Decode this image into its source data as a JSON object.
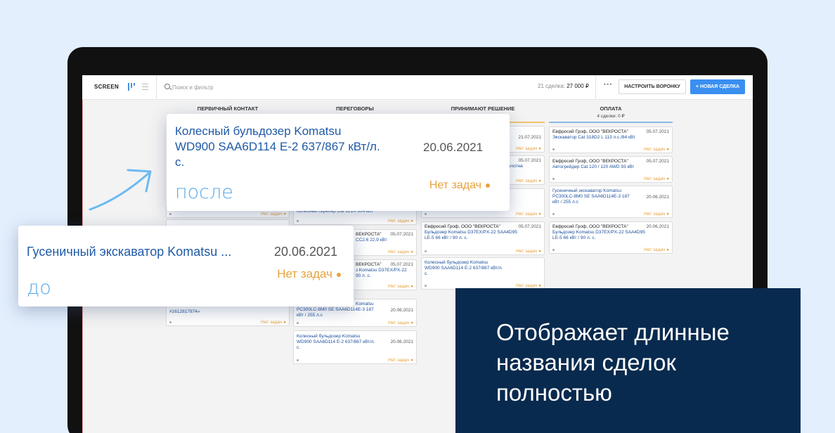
{
  "app": {
    "brand": "SCREEN"
  },
  "toolbar": {
    "search_placeholder": "Поиск и фильтр",
    "summary_count": "21 сделка:",
    "summary_amount": "27 000 ₽",
    "more_label": "···",
    "setup_label": "НАСТРОИТЬ ВОРОНКУ",
    "new_deal_label": "+ НОВАЯ СДЕЛКА"
  },
  "columns": [
    {
      "title": "ПЕРВИЧНЫЙ КОНТАКТ",
      "subtitle": "",
      "color": "#f0c36d"
    },
    {
      "title": "ПЕРЕГОВОРЫ",
      "subtitle": "",
      "color": "#f0c36d"
    },
    {
      "title": "ПРИНИМАЮТ РЕШЕНИЕ",
      "subtitle": "",
      "color": "#f0c36d"
    },
    {
      "title": "ОПЛАТА",
      "subtitle": "4 сделки: 0 ₽",
      "color": "#8cb8e8"
    }
  ],
  "cards": {
    "c1_a": {
      "task": "Нет задач ●"
    },
    "c1_b": {
      "title": "#1612817974»",
      "task": "Нет задач ●"
    },
    "c2_a": {
      "title": "Колесный скрепер Cat 621K 304 кВт",
      "task": "Нет задач ●"
    },
    "c2_b": {
      "contact": "ВЕКРОСТА\"",
      "date": "05.07.2021",
      "title": "СС2.6 22,9 кВт",
      "task": "Нет задач ●"
    },
    "c2_c": {
      "contact": "ВЕКРОСТА\"",
      "date": "05.07.2021",
      "title": "з Komatsu D37EX/PX-22",
      "title2": "90 л. с.",
      "task": "Нет задач ●"
    },
    "c2_d": {
      "title": "Komatsu",
      "title2": "PC300LC-8M0 SE SAA6D114E-3 187",
      "title3": "кВт / 255 л.с",
      "date": "20.06.2021",
      "task": "Нет задач ●"
    },
    "c2_e": {
      "title": "Колесный бульдозер Komatsu",
      "title2": "WD900 SAA6D114 E-2 637/867 кВт/л.",
      "title3": "с.",
      "date": "20.06.2021",
      "task": "Нет задач ●"
    },
    "c3_a": {
      "date": "21.07.2021",
      "task": "Нет задач ●"
    },
    "c3_b": {
      "date": "05.07.2021",
      "title": "ого полотна",
      "task": "Нет задач ●"
    },
    "c3_c": {
      "title": "В3",
      "task": "Нет задач ●"
    },
    "c3_d": {
      "contact": "Евфросий Гроф, ООО \"ВЕКРОСТА\"",
      "date": "05.07.2021",
      "title": "Бульдозер Komatsu D37EX/PX-22 SAA4D95",
      "title2": "LE-5 66 кВт / 90 л. с.",
      "task": "Нет задач ●"
    },
    "c3_e": {
      "title": "Колесный бульдозер Komatsu",
      "title2": "WD900 SAA6D114 E-2 637/867 кВт/л.",
      "title3": "с.",
      "date": "20.06.2021",
      "task": "Нет задач ●"
    },
    "c4_a": {
      "contact": "Евфросий Гроф, ООО \"ВЕКРОСТА\"",
      "date": "05.07.2021",
      "title": "Экскаватор Cat 318D2 L 113 л.с./84 кВт",
      "task": "Нет задач ●"
    },
    "c4_b": {
      "contact": "Евфросий Гроф, ООО \"ВЕКРОСТА\"",
      "date": "05.07.2021",
      "title": "Автогрейдер Cat 120 / 120 AWD 93 кВт",
      "task": "Нет задач ●"
    },
    "c4_c": {
      "title": "Гусеничный экскаватор Komatsu",
      "title2": "PC300LC-8M0 SE SAA6D114E-3 187",
      "title3": "кВт / 255 л.с",
      "date": "20.06.2021",
      "task": "Нет задач ●"
    },
    "c4_d": {
      "contact": "Евфросий Гроф, ООО \"ВЕКРОСТА\"",
      "date": "20.06.2021",
      "title": "Бульдозер Komatsu D37EX/PX-22 SAA4D95",
      "title2": "LE-5 66 кВт / 90 л. с.",
      "task": "Нет задач ●"
    }
  },
  "zoom_after": {
    "title_line1": "Колесный бульдозер Komatsu",
    "title_line2": "WD900 SAA6D114 E-2 637/867 кВт/л.",
    "title_line3": "с.",
    "date": "20.06.2021",
    "task": "Нет задач",
    "label": "после"
  },
  "zoom_before": {
    "title": "Гусеничный экскаватор Komatsu ...",
    "date": "20.06.2021",
    "task": "Нет задач",
    "label": "до"
  },
  "promo": {
    "text": "Отображает длинные названия сделок полностью"
  },
  "colors": {
    "accent": "#3a8ff0",
    "task": "#e8a23a",
    "panel": "#082a4e",
    "background": "#e3effd"
  }
}
